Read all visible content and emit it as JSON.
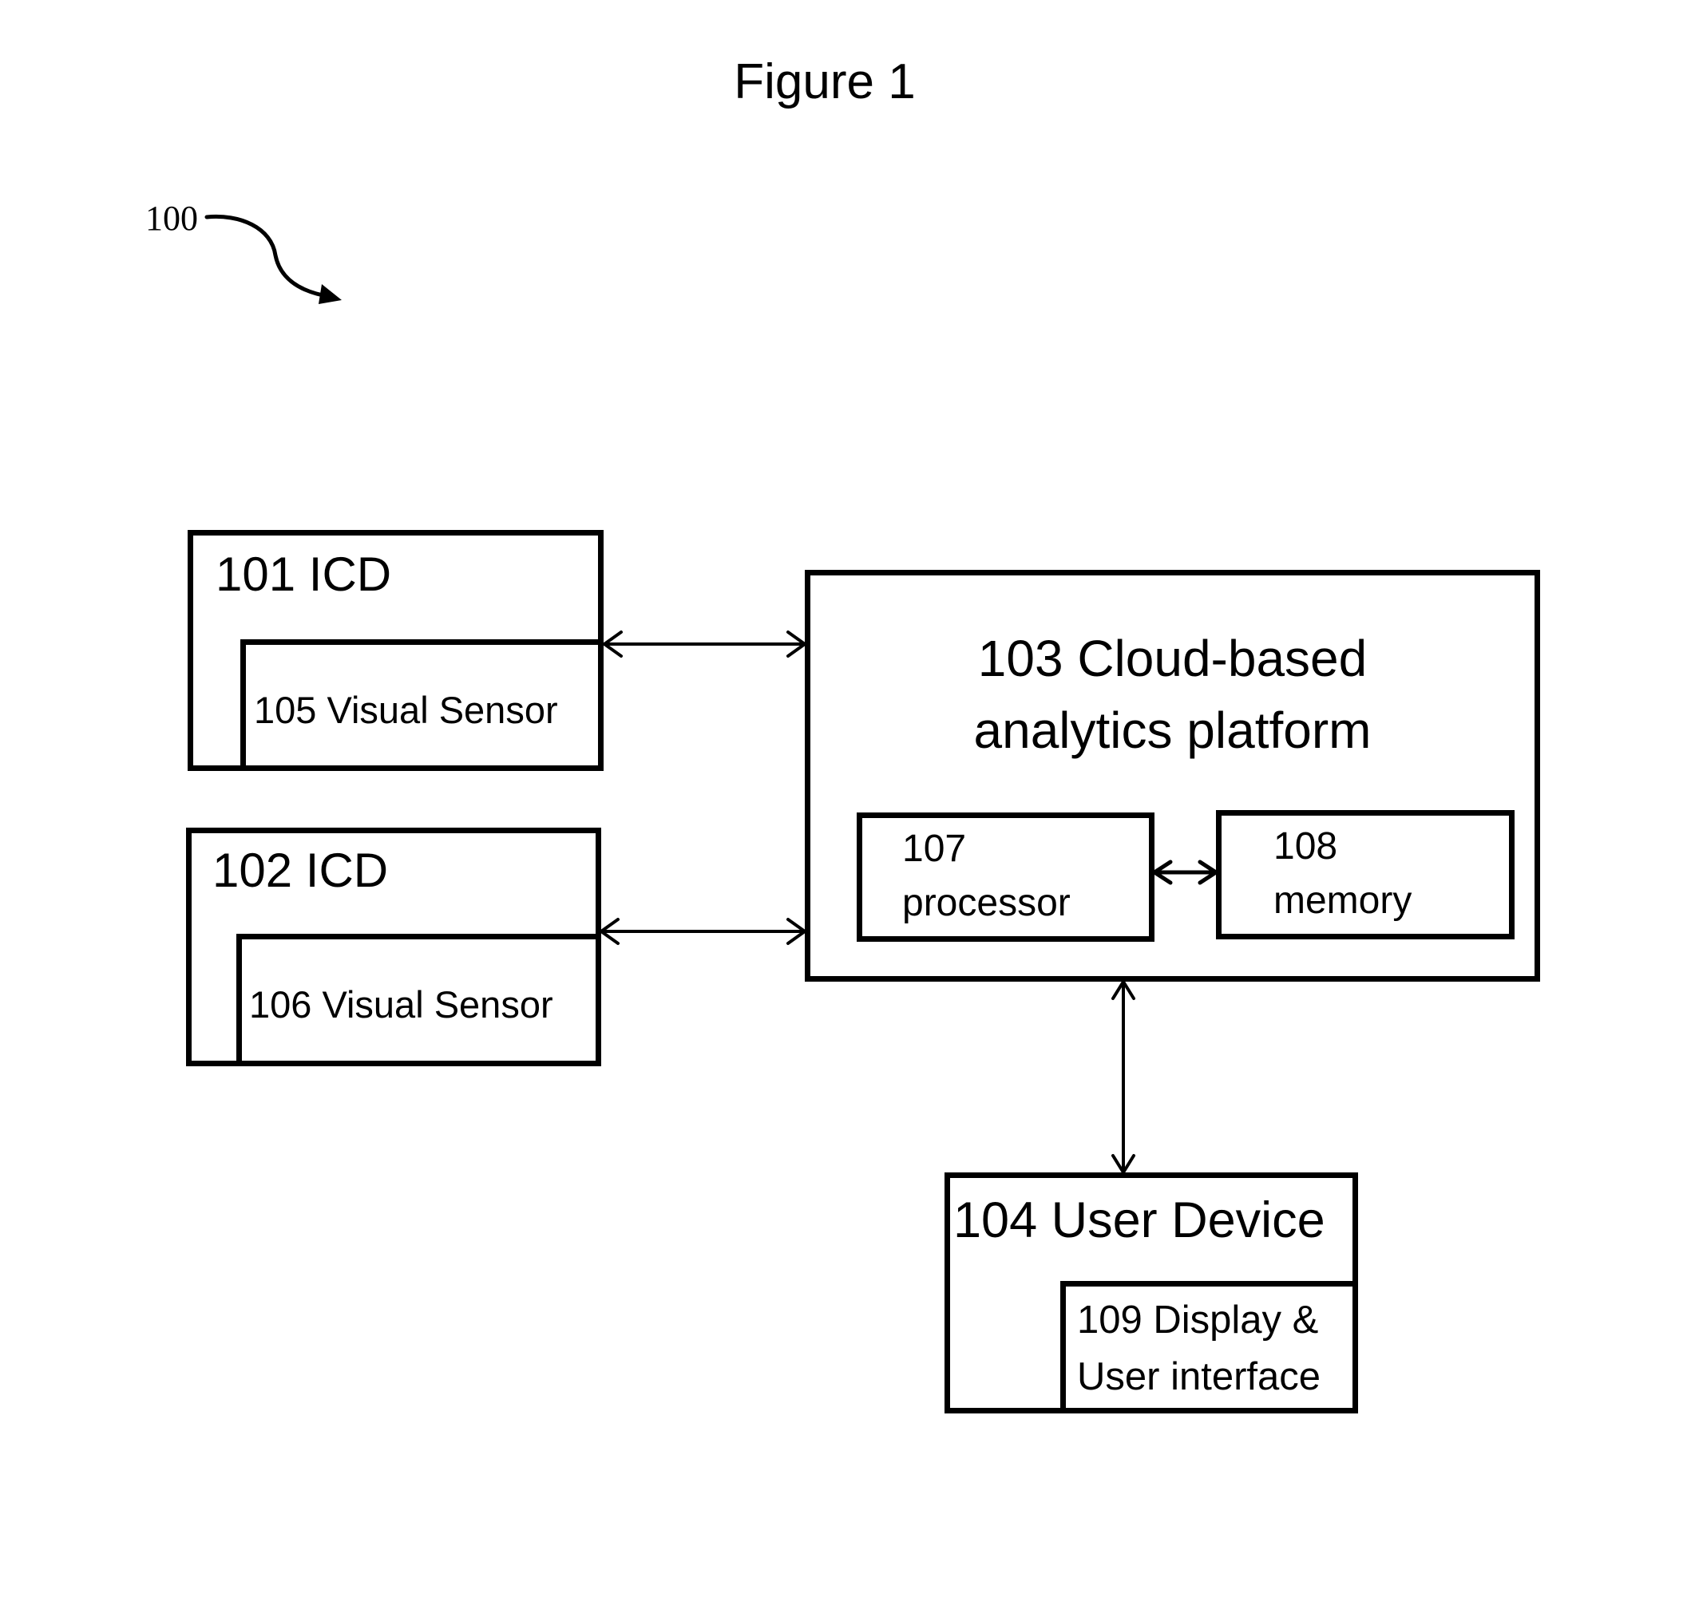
{
  "figure": {
    "title": "Figure 1",
    "reference": "100"
  },
  "nodes": {
    "icd_101": {
      "label": "101 ICD"
    },
    "sensor_105": {
      "label": "105 Visual Sensor"
    },
    "icd_102": {
      "label": "102 ICD"
    },
    "sensor_106": {
      "label": "106 Visual Sensor"
    },
    "platform_103": {
      "label_line1": "103 Cloud-based",
      "label_line2": "analytics platform"
    },
    "processor_107": {
      "label_line1": "107",
      "label_line2": "processor"
    },
    "memory_108": {
      "label_line1": "108",
      "label_line2": "memory"
    },
    "user_device_104": {
      "label": "104 User Device"
    },
    "display_109": {
      "label_line1": "109 Display &",
      "label_line2": "User interface"
    }
  },
  "edges": [
    {
      "from": "101 ICD",
      "to": "103 Cloud-based analytics platform",
      "direction": "bidirectional"
    },
    {
      "from": "102 ICD",
      "to": "103 Cloud-based analytics platform",
      "direction": "bidirectional"
    },
    {
      "from": "107 processor",
      "to": "108 memory",
      "direction": "bidirectional"
    },
    {
      "from": "103 Cloud-based analytics platform",
      "to": "104 User Device",
      "direction": "bidirectional"
    }
  ]
}
